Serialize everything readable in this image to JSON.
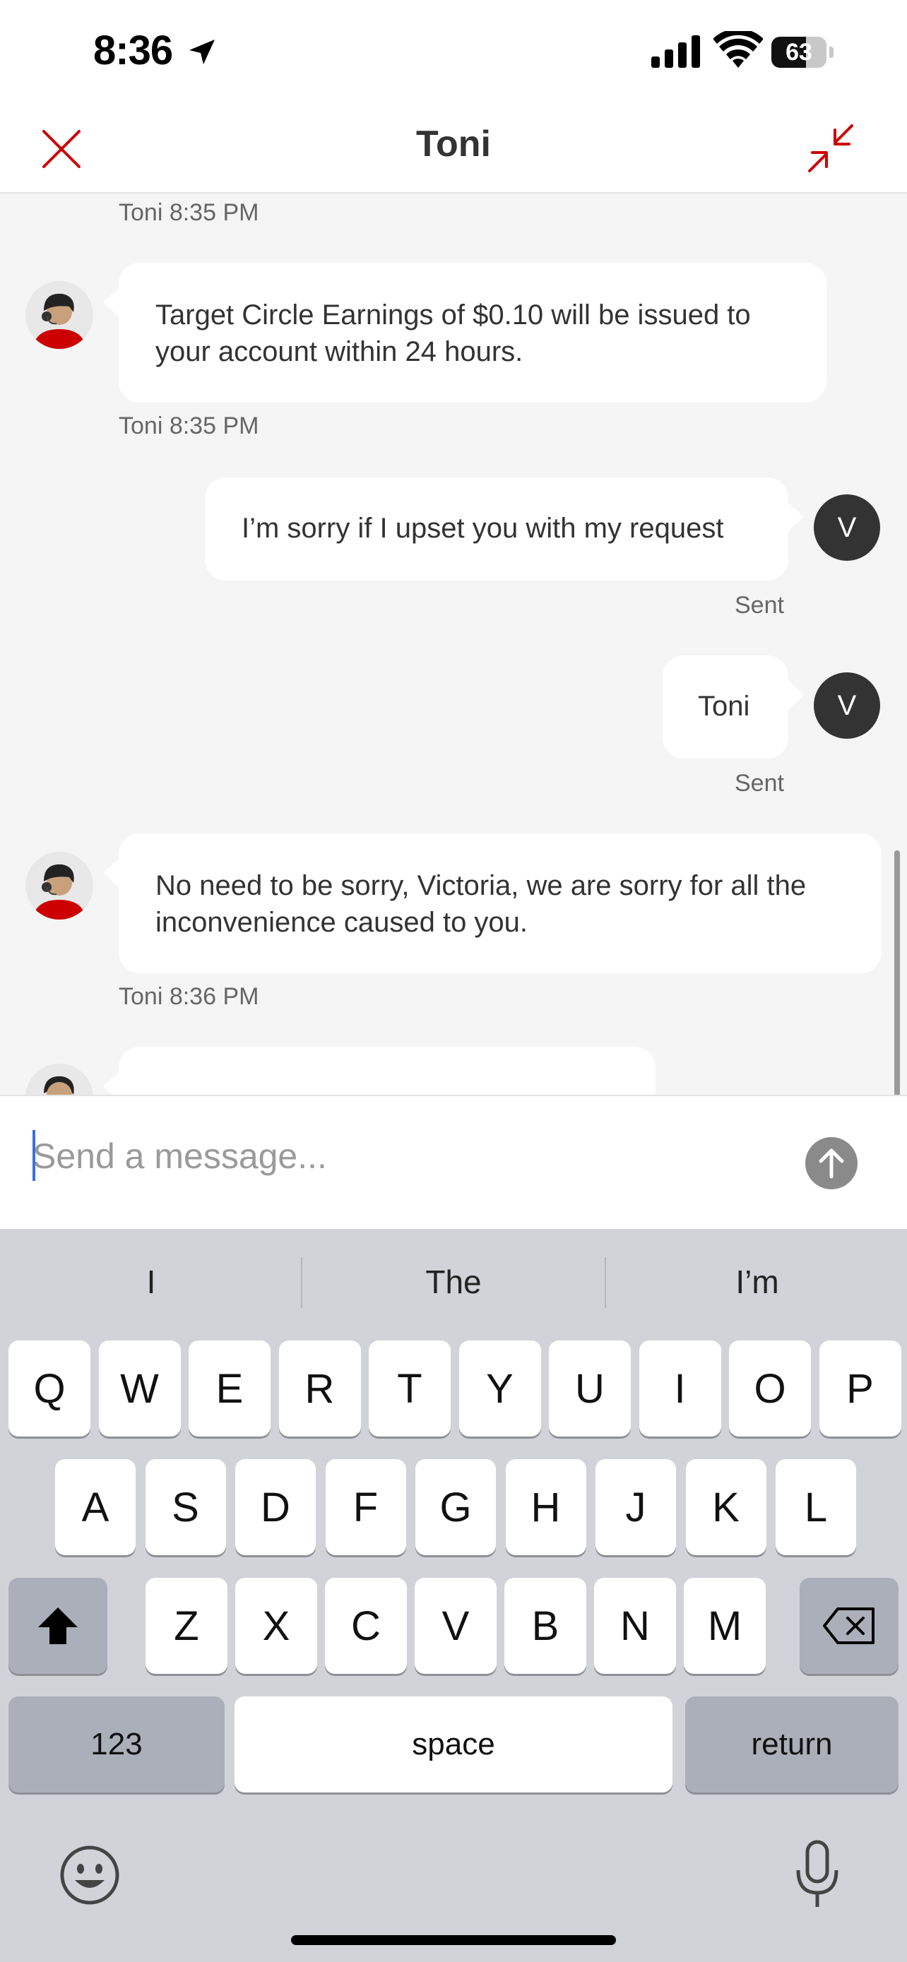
{
  "status_bar": {
    "time": "8:36",
    "battery": "63",
    "battery_level": 0.63
  },
  "header": {
    "title": "Toni"
  },
  "messages": [
    {
      "meta": "Toni 8:35 PM"
    },
    {
      "from": "agent",
      "lines": [
        "Target Circle Earnings of $0.10 will be issued to",
        "your account within 24 hours."
      ],
      "meta": "Toni 8:35 PM"
    },
    {
      "from": "user",
      "avatar": "V",
      "text": "I’m sorry if I upset you with my request",
      "meta": "Sent"
    },
    {
      "from": "user",
      "avatar": "V",
      "text": "Toni",
      "meta": "Sent"
    },
    {
      "from": "agent",
      "lines": [
        "No need to be sorry, Victoria, we are sorry for all the",
        "inconvenience caused to you."
      ],
      "meta": "Toni 8:36 PM"
    }
  ],
  "composer": {
    "placeholder": "Send a message..."
  },
  "keyboard": {
    "suggestions": [
      "I",
      "The",
      "I’m"
    ],
    "row1": [
      "Q",
      "W",
      "E",
      "R",
      "T",
      "Y",
      "U",
      "I",
      "O",
      "P"
    ],
    "row2": [
      "A",
      "S",
      "D",
      "F",
      "G",
      "H",
      "J",
      "K",
      "L"
    ],
    "row3": [
      "Z",
      "X",
      "C",
      "V",
      "B",
      "N",
      "M"
    ],
    "numbers": "123",
    "space": "space",
    "return": "return"
  },
  "colors": {
    "accent": "#cc0000",
    "bubble": "#ffffff",
    "background": "#f5f5f6",
    "user_avatar": "#333333"
  }
}
